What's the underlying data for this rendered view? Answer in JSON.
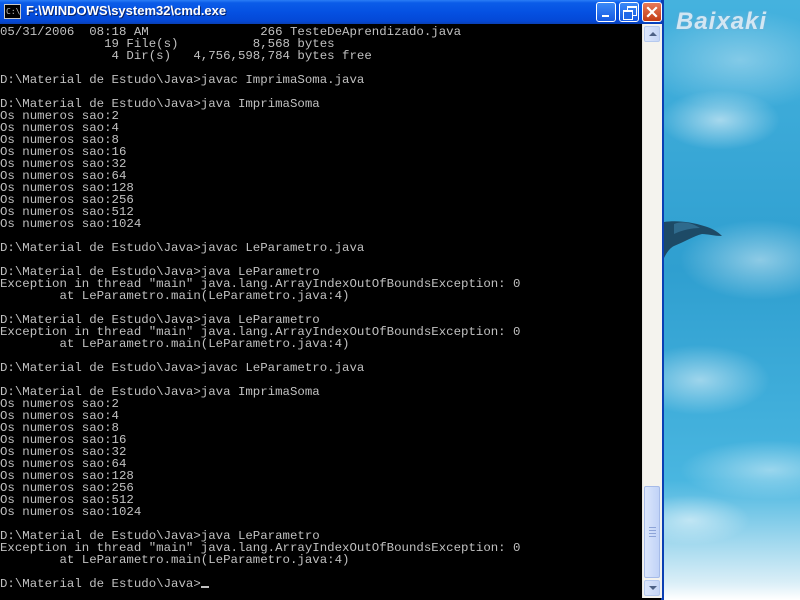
{
  "window": {
    "title": "F:\\WINDOWS\\system32\\cmd.exe",
    "icon_label": "C:\\",
    "buttons": [
      "minimize",
      "maximize",
      "close"
    ]
  },
  "desktop": {
    "watermark": "Baixaki"
  },
  "console": {
    "lines": [
      "05/31/2006  08:18 AM               266 TesteDeAprendizado.java",
      "              19 File(s)          8,568 bytes",
      "               4 Dir(s)   4,756,598,784 bytes free",
      "",
      "D:\\Material de Estudo\\Java>javac ImprimaSoma.java",
      "",
      "D:\\Material de Estudo\\Java>java ImprimaSoma",
      "Os numeros sao:2",
      "Os numeros sao:4",
      "Os numeros sao:8",
      "Os numeros sao:16",
      "Os numeros sao:32",
      "Os numeros sao:64",
      "Os numeros sao:128",
      "Os numeros sao:256",
      "Os numeros sao:512",
      "Os numeros sao:1024",
      "",
      "D:\\Material de Estudo\\Java>javac LeParametro.java",
      "",
      "D:\\Material de Estudo\\Java>java LeParametro",
      "Exception in thread \"main\" java.lang.ArrayIndexOutOfBoundsException: 0",
      "        at LeParametro.main(LeParametro.java:4)",
      "",
      "D:\\Material de Estudo\\Java>java LeParametro",
      "Exception in thread \"main\" java.lang.ArrayIndexOutOfBoundsException: 0",
      "        at LeParametro.main(LeParametro.java:4)",
      "",
      "D:\\Material de Estudo\\Java>javac LeParametro.java",
      "",
      "D:\\Material de Estudo\\Java>java ImprimaSoma",
      "Os numeros sao:2",
      "Os numeros sao:4",
      "Os numeros sao:8",
      "Os numeros sao:16",
      "Os numeros sao:32",
      "Os numeros sao:64",
      "Os numeros sao:128",
      "Os numeros sao:256",
      "Os numeros sao:512",
      "Os numeros sao:1024",
      "",
      "D:\\Material de Estudo\\Java>java LeParametro",
      "Exception in thread \"main\" java.lang.ArrayIndexOutOfBoundsException: 0",
      "        at LeParametro.main(LeParametro.java:4)",
      "",
      "D:\\Material de Estudo\\Java>"
    ]
  },
  "colors": {
    "console_background": "#000000",
    "console_text": "#c0c0c0",
    "titlebar": "#0551e2"
  }
}
